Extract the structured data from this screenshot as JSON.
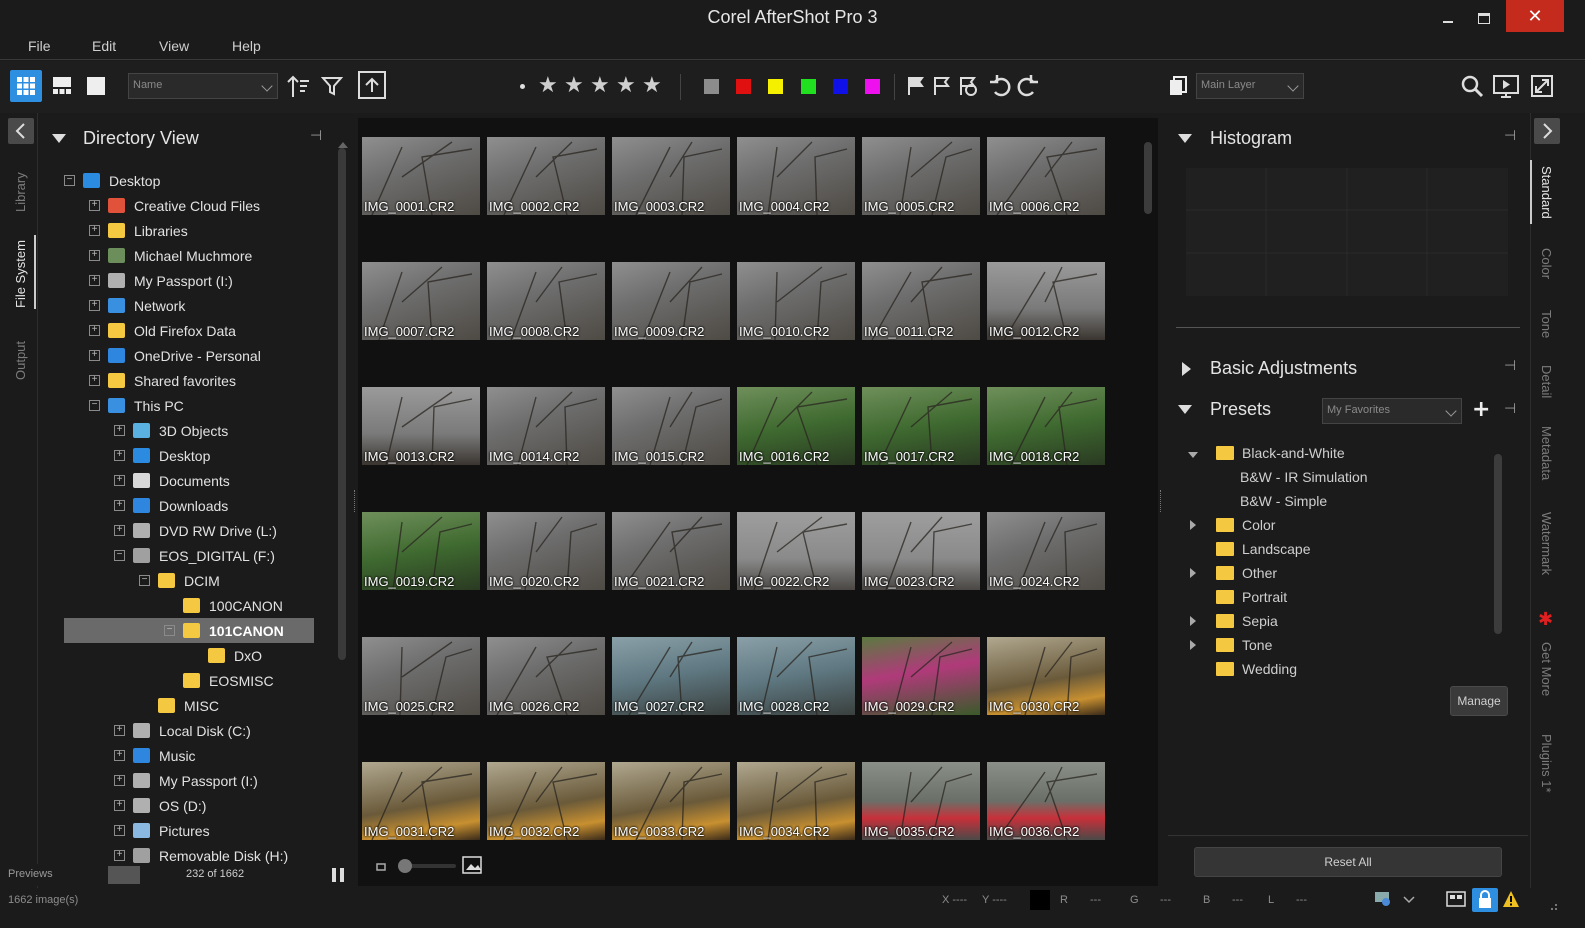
{
  "window": {
    "title": "Corel AfterShot Pro 3"
  },
  "menu": [
    "File",
    "Edit",
    "View",
    "Help"
  ],
  "toolbar": {
    "sort_combo": "Name",
    "layer_combo": "Main Layer",
    "color_labels": [
      "#8c8c8c",
      "#e01010",
      "#f4f000",
      "#20e020",
      "#1010e8",
      "#ee10ee"
    ]
  },
  "left_tabs": [
    "Library",
    "File System",
    "Output"
  ],
  "right_tabs": [
    "Standard",
    "Color",
    "Tone",
    "Detail",
    "Metadata",
    "Watermark",
    "Get More",
    "Plugins 1*"
  ],
  "directory": {
    "title": "Directory View",
    "items": [
      {
        "label": "Desktop",
        "depth": 0,
        "icon": "desktop",
        "exp": "-"
      },
      {
        "label": "Creative Cloud Files",
        "depth": 1,
        "icon": "cc",
        "exp": "+"
      },
      {
        "label": "Libraries",
        "depth": 1,
        "icon": "libraries",
        "exp": "+"
      },
      {
        "label": "Michael Muchmore",
        "depth": 1,
        "icon": "user",
        "exp": "+"
      },
      {
        "label": "My Passport (I:)",
        "depth": 1,
        "icon": "drive",
        "exp": "+"
      },
      {
        "label": "Network",
        "depth": 1,
        "icon": "network",
        "exp": "+"
      },
      {
        "label": "Old Firefox Data",
        "depth": 1,
        "icon": "folder",
        "exp": "+"
      },
      {
        "label": "OneDrive - Personal",
        "depth": 1,
        "icon": "cloud",
        "exp": "+"
      },
      {
        "label": "Shared favorites",
        "depth": 1,
        "icon": "folder",
        "exp": "+"
      },
      {
        "label": "This PC",
        "depth": 1,
        "icon": "pc",
        "exp": "-"
      },
      {
        "label": "3D Objects",
        "depth": 2,
        "icon": "cube",
        "exp": "+"
      },
      {
        "label": "Desktop",
        "depth": 2,
        "icon": "desktop",
        "exp": "+"
      },
      {
        "label": "Documents",
        "depth": 2,
        "icon": "doc",
        "exp": "+"
      },
      {
        "label": "Downloads",
        "depth": 2,
        "icon": "download",
        "exp": "+"
      },
      {
        "label": "DVD RW Drive (L:)",
        "depth": 2,
        "icon": "dvd",
        "exp": "+"
      },
      {
        "label": "EOS_DIGITAL (F:)",
        "depth": 2,
        "icon": "sd",
        "exp": "-"
      },
      {
        "label": "DCIM",
        "depth": 3,
        "icon": "folder",
        "exp": "-"
      },
      {
        "label": "100CANON",
        "depth": 4,
        "icon": "folder",
        "exp": ""
      },
      {
        "label": "101CANON",
        "depth": 4,
        "icon": "folder",
        "exp": "-",
        "selected": true
      },
      {
        "label": "DxO",
        "depth": 5,
        "icon": "folder",
        "exp": ""
      },
      {
        "label": "EOSMISC",
        "depth": 4,
        "icon": "folder",
        "exp": ""
      },
      {
        "label": "MISC",
        "depth": 3,
        "icon": "folder",
        "exp": ""
      },
      {
        "label": "Local Disk (C:)",
        "depth": 2,
        "icon": "disk",
        "exp": "+"
      },
      {
        "label": "Music",
        "depth": 2,
        "icon": "music",
        "exp": "+"
      },
      {
        "label": "My Passport (I:)",
        "depth": 2,
        "icon": "drive",
        "exp": "+"
      },
      {
        "label": "OS (D:)",
        "depth": 2,
        "icon": "drive",
        "exp": "+"
      },
      {
        "label": "Pictures",
        "depth": 2,
        "icon": "pictures",
        "exp": "+"
      },
      {
        "label": "Removable Disk (H:)",
        "depth": 2,
        "icon": "sd",
        "exp": "+"
      }
    ],
    "previews_label": "Previews",
    "count": "232 of 1662"
  },
  "thumbnails": [
    "IMG_0001.CR2",
    "IMG_0002.CR2",
    "IMG_0003.CR2",
    "IMG_0004.CR2",
    "IMG_0005.CR2",
    "IMG_0006.CR2",
    "IMG_0007.CR2",
    "IMG_0008.CR2",
    "IMG_0009.CR2",
    "IMG_0010.CR2",
    "IMG_0011.CR2",
    "IMG_0012.CR2",
    "IMG_0013.CR2",
    "IMG_0014.CR2",
    "IMG_0015.CR2",
    "IMG_0016.CR2",
    "IMG_0017.CR2",
    "IMG_0018.CR2",
    "IMG_0019.CR2",
    "IMG_0020.CR2",
    "IMG_0021.CR2",
    "IMG_0022.CR2",
    "IMG_0023.CR2",
    "IMG_0024.CR2",
    "IMG_0025.CR2",
    "IMG_0026.CR2",
    "IMG_0027.CR2",
    "IMG_0028.CR2",
    "IMG_0029.CR2",
    "IMG_0030.CR2",
    "IMG_0031.CR2",
    "IMG_0032.CR2",
    "IMG_0033.CR2",
    "IMG_0034.CR2",
    "IMG_0035.CR2",
    "IMG_0036.CR2"
  ],
  "thumb_tones": [
    "branches",
    "branches",
    "branches",
    "branches",
    "branches",
    "branches",
    "branches",
    "branches",
    "branches",
    "branches",
    "branches",
    "bird",
    "bird",
    "branches",
    "branches",
    "green",
    "green",
    "green",
    "green",
    "branches",
    "branches",
    "grey",
    "grey",
    "branches",
    "branches",
    "branches",
    "teal",
    "teal",
    "pink",
    "warm",
    "warm",
    "warm",
    "warm",
    "warm",
    "feeder",
    "feeder"
  ],
  "right": {
    "histogram_title": "Histogram",
    "basic_title": "Basic Adjustments",
    "presets_title": "Presets",
    "presets_combo": "My Favorites",
    "presets": [
      {
        "label": "Black-and-White",
        "type": "folder",
        "expanded": true,
        "depth": 0
      },
      {
        "label": "B&W - IR Simulation",
        "type": "item",
        "depth": 1
      },
      {
        "label": "B&W - Simple",
        "type": "item",
        "depth": 1
      },
      {
        "label": "Color",
        "type": "folder",
        "collapsed": true,
        "depth": 0
      },
      {
        "label": "Landscape",
        "type": "folder",
        "depth": 0
      },
      {
        "label": "Other",
        "type": "folder",
        "collapsed": true,
        "depth": 0
      },
      {
        "label": "Portrait",
        "type": "folder",
        "depth": 0
      },
      {
        "label": "Sepia",
        "type": "folder",
        "collapsed": true,
        "depth": 0
      },
      {
        "label": "Tone",
        "type": "folder",
        "collapsed": true,
        "depth": 0
      },
      {
        "label": "Wedding",
        "type": "folder",
        "depth": 0
      }
    ],
    "manage_label": "Manage",
    "reset_label": "Reset All"
  },
  "status": {
    "images": "1662 image(s)",
    "x": "X ----",
    "y": "Y ----",
    "r_label": "R",
    "r_val": "---",
    "g_label": "G",
    "g_val": "---",
    "b_label": "B",
    "b_val": "---",
    "l_label": "L",
    "l_val": "---"
  }
}
